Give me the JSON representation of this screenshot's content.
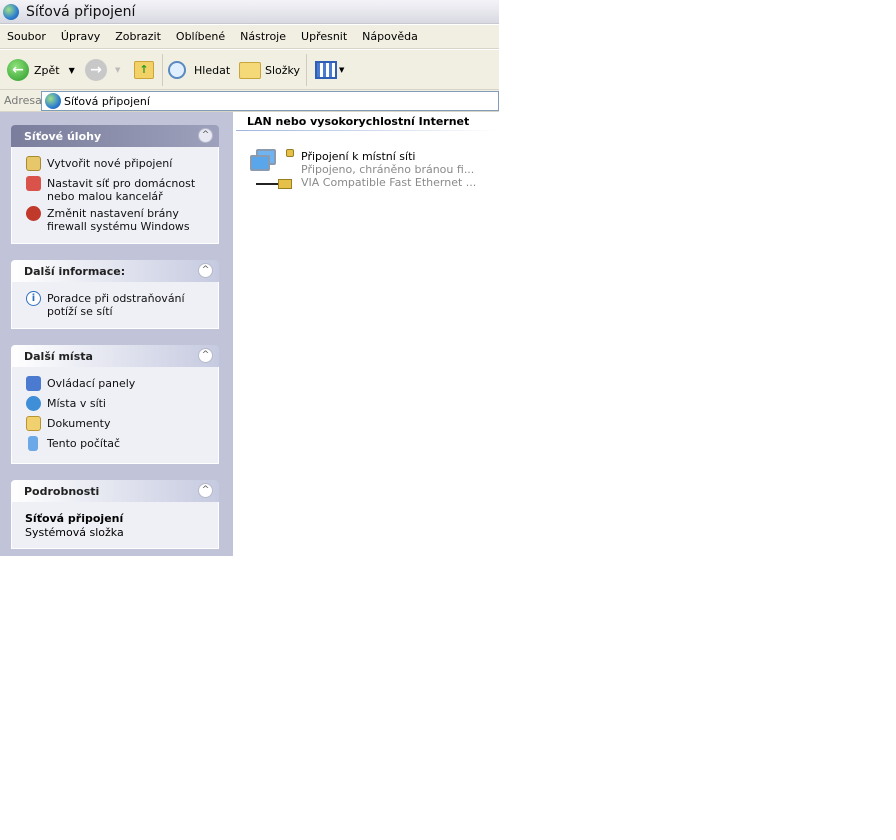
{
  "window": {
    "title": "Síťová připojení"
  },
  "menu": [
    "Soubor",
    "Úpravy",
    "Zobrazit",
    "Oblíbené",
    "Nástroje",
    "Upřesnit",
    "Nápověda"
  ],
  "toolbar": {
    "back": "Zpět",
    "search": "Hledat",
    "folders": "Složky"
  },
  "address": {
    "label": "Adresa",
    "value": "Síťová připojení"
  },
  "panels": {
    "tasks": {
      "title": "Síťové úlohy",
      "items": [
        "Vytvořit nové připojení",
        "Nastavit síť pro domácnost nebo malou kancelář",
        "Změnit nastavení brány firewall systému Windows"
      ]
    },
    "info": {
      "title": "Další informace:",
      "items": [
        "Poradce při odstraňování potíží se sítí"
      ]
    },
    "places": {
      "title": "Další místa",
      "items": [
        "Ovládací panely",
        "Místa v síti",
        "Dokumenty",
        "Tento počítač"
      ]
    },
    "details": {
      "title": "Podrobnosti",
      "name": "Síťová připojení",
      "type": "Systémová složka"
    }
  },
  "content": {
    "group": "LAN nebo vysokorychlostní Internet",
    "connection": {
      "name": "Připojení k místní síti",
      "status": "Připojeno, chráněno bránou fi...",
      "device": "VIA Compatible Fast Ethernet ..."
    }
  }
}
